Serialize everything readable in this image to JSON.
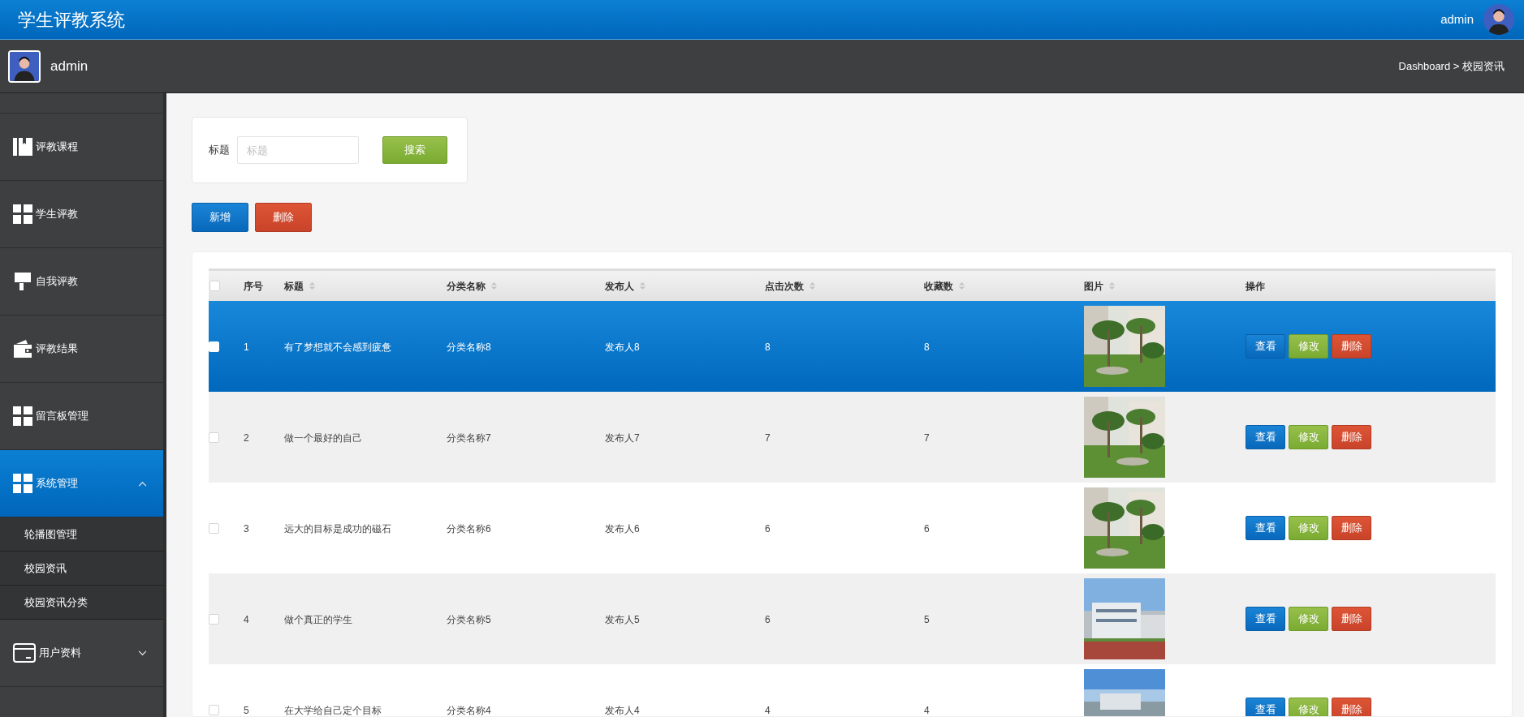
{
  "header": {
    "title": "学生评教系统",
    "user": "admin"
  },
  "subheader": {
    "user": "admin",
    "breadcrumb": "Dashboard > 校园资讯"
  },
  "sidebar": {
    "items": [
      {
        "label": "评教课程",
        "selected": false
      },
      {
        "label": "学生评教",
        "selected": false
      },
      {
        "label": "自我评教",
        "selected": false
      },
      {
        "label": "评教结果",
        "selected": false
      },
      {
        "label": "留言板管理",
        "selected": false
      },
      {
        "label": "系统管理",
        "selected": true,
        "expanded": true,
        "children": [
          {
            "label": "轮播图管理"
          },
          {
            "label": "校园资讯"
          },
          {
            "label": "校园资讯分类"
          }
        ]
      },
      {
        "label": "用户资料",
        "selected": false,
        "expanded": false
      }
    ]
  },
  "search": {
    "label": "标题",
    "placeholder": "标题",
    "button": "搜索"
  },
  "actions": [
    "新增",
    "删除"
  ],
  "table": {
    "header_checked": false,
    "columns": [
      {
        "label": "序号",
        "sortable": false
      },
      {
        "label": "标题",
        "sortable": true
      },
      {
        "label": "分类名称",
        "sortable": true
      },
      {
        "label": "发布人",
        "sortable": true
      },
      {
        "label": "点击次数",
        "sortable": true
      },
      {
        "label": "收藏数",
        "sortable": true
      },
      {
        "label": "图片",
        "sortable": true
      },
      {
        "label": "操作",
        "sortable": false
      }
    ],
    "rows": [
      {
        "selected": true,
        "checked": false,
        "cells": [
          "1",
          "有了梦想就不会感到疲惫",
          "分类名称8",
          "发布人8",
          "8",
          "8"
        ],
        "buttons": [
          "查看",
          "修改",
          "删除"
        ]
      },
      {
        "selected": false,
        "checked": false,
        "cells": [
          "2",
          "做一个最好的自己",
          "分类名称7",
          "发布人7",
          "7",
          "7"
        ],
        "buttons": [
          "查看",
          "修改",
          "删除"
        ]
      },
      {
        "selected": false,
        "checked": false,
        "cells": [
          "3",
          "远大的目标是成功的磁石",
          "分类名称6",
          "发布人6",
          "6",
          "6"
        ],
        "buttons": [
          "查看",
          "修改",
          "删除"
        ]
      },
      {
        "selected": false,
        "checked": false,
        "cells": [
          "4",
          "做个真正的学生",
          "分类名称5",
          "发布人5",
          "6",
          "5"
        ],
        "buttons": [
          "查看",
          "修改",
          "删除"
        ]
      },
      {
        "selected": false,
        "checked": false,
        "cells": [
          "5",
          "在大学给自己定个目标",
          "分类名称4",
          "发布人4",
          "4",
          "4"
        ],
        "buttons": [
          "查看",
          "修改",
          "删除"
        ]
      }
    ]
  }
}
